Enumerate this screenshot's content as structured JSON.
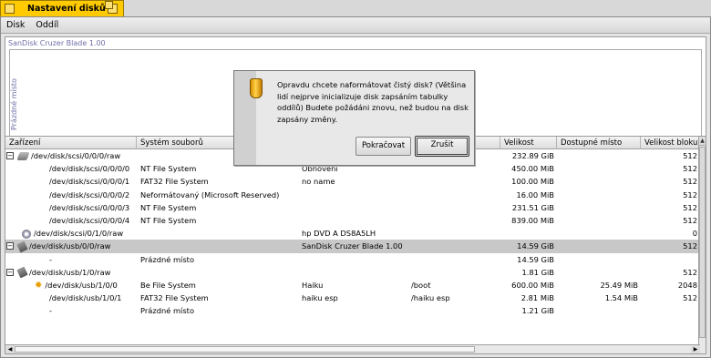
{
  "window": {
    "title": "Nastavení disků"
  },
  "menu": {
    "disk": "Disk",
    "partition": "Oddíl"
  },
  "disk_view": {
    "disk_name": "SanDisk Cruzer Blade 1.00",
    "empty_label": "Prázdné místo"
  },
  "table": {
    "headers": [
      "Zařízení",
      "Systém souborů",
      "",
      "",
      "Velikost",
      "Dostupné místo",
      "Velikost bloku"
    ],
    "rows": [
      {
        "device": "/dev/disk/scsi/0/0/0/raw",
        "fs": "",
        "name": "",
        "mount": "",
        "size": "232.89 GiB",
        "free": "",
        "block": "512"
      },
      {
        "device": "/dev/disk/scsi/0/0/0/0",
        "fs": "NT File System",
        "name": "Obnovení",
        "mount": "",
        "size": "450.00 MiB",
        "free": "",
        "block": "512"
      },
      {
        "device": "/dev/disk/scsi/0/0/0/1",
        "fs": "FAT32 File System",
        "name": "no name",
        "mount": "",
        "size": "100.00 MiB",
        "free": "",
        "block": "512"
      },
      {
        "device": "/dev/disk/scsi/0/0/0/2",
        "fs": "Neformátovaný (Microsoft Reserved)",
        "name": "",
        "mount": "",
        "size": "16.00 MiB",
        "free": "",
        "block": "512"
      },
      {
        "device": "/dev/disk/scsi/0/0/0/3",
        "fs": "NT File System",
        "name": "",
        "mount": "",
        "size": "231.51 GiB",
        "free": "",
        "block": "512"
      },
      {
        "device": "/dev/disk/scsi/0/0/0/4",
        "fs": "NT File System",
        "name": "",
        "mount": "",
        "size": "839.00 MiB",
        "free": "",
        "block": "512"
      },
      {
        "device": "/dev/disk/scsi/0/1/0/raw",
        "fs": "",
        "name": "hp DVD A  DS8A5LH",
        "mount": "",
        "size": "",
        "free": "",
        "block": "0"
      },
      {
        "device": "/dev/disk/usb/0/0/raw",
        "fs": "",
        "name": "SanDisk Cruzer Blade 1.00",
        "mount": "",
        "size": "14.59 GiB",
        "free": "",
        "block": "512"
      },
      {
        "device": "-",
        "fs": "Prázdné místo",
        "name": "",
        "mount": "",
        "size": "14.59 GiB",
        "free": "",
        "block": ""
      },
      {
        "device": "/dev/disk/usb/1/0/raw",
        "fs": "",
        "name": "",
        "mount": "",
        "size": "1.81 GiB",
        "free": "",
        "block": "512"
      },
      {
        "device": "/dev/disk/usb/1/0/0",
        "fs": "Be File System",
        "name": "Haiku",
        "mount": "/boot",
        "size": "600.00 MiB",
        "free": "25.49 MiB",
        "block": "2048"
      },
      {
        "device": "/dev/disk/usb/1/0/1",
        "fs": "FAT32 File System",
        "name": "haiku esp",
        "mount": "/haiku esp",
        "size": "2.81 MiB",
        "free": "1.54 MiB",
        "block": "512"
      },
      {
        "device": "-",
        "fs": "Prázdné místo",
        "name": "",
        "mount": "",
        "size": "1.21 GiB",
        "free": "",
        "block": ""
      }
    ]
  },
  "dialog": {
    "message": "Opravdu chcete naformátovat čistý disk? (Většina lidí nejprve inicializuje disk zapsáním tabulky oddílů) Budete požádáni znovu, než budou na disk zapsány změny.",
    "continue_label": "Pokračovat",
    "cancel_label": "Zrušit"
  }
}
